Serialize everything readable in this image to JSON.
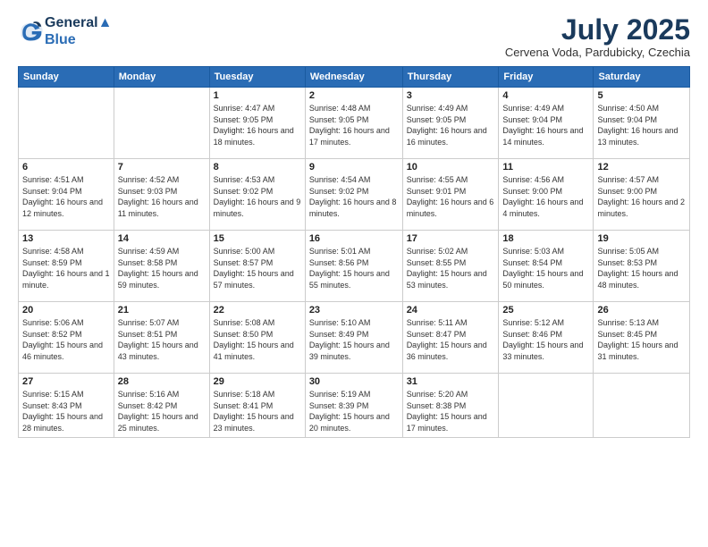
{
  "logo": {
    "line1": "General",
    "line2": "Blue"
  },
  "title": "July 2025",
  "location": "Cervena Voda, Pardubicky, Czechia",
  "weekdays": [
    "Sunday",
    "Monday",
    "Tuesday",
    "Wednesday",
    "Thursday",
    "Friday",
    "Saturday"
  ],
  "weeks": [
    [
      {
        "day": "",
        "info": ""
      },
      {
        "day": "",
        "info": ""
      },
      {
        "day": "1",
        "info": "Sunrise: 4:47 AM\nSunset: 9:05 PM\nDaylight: 16 hours and 18 minutes."
      },
      {
        "day": "2",
        "info": "Sunrise: 4:48 AM\nSunset: 9:05 PM\nDaylight: 16 hours and 17 minutes."
      },
      {
        "day": "3",
        "info": "Sunrise: 4:49 AM\nSunset: 9:05 PM\nDaylight: 16 hours and 16 minutes."
      },
      {
        "day": "4",
        "info": "Sunrise: 4:49 AM\nSunset: 9:04 PM\nDaylight: 16 hours and 14 minutes."
      },
      {
        "day": "5",
        "info": "Sunrise: 4:50 AM\nSunset: 9:04 PM\nDaylight: 16 hours and 13 minutes."
      }
    ],
    [
      {
        "day": "6",
        "info": "Sunrise: 4:51 AM\nSunset: 9:04 PM\nDaylight: 16 hours and 12 minutes."
      },
      {
        "day": "7",
        "info": "Sunrise: 4:52 AM\nSunset: 9:03 PM\nDaylight: 16 hours and 11 minutes."
      },
      {
        "day": "8",
        "info": "Sunrise: 4:53 AM\nSunset: 9:02 PM\nDaylight: 16 hours and 9 minutes."
      },
      {
        "day": "9",
        "info": "Sunrise: 4:54 AM\nSunset: 9:02 PM\nDaylight: 16 hours and 8 minutes."
      },
      {
        "day": "10",
        "info": "Sunrise: 4:55 AM\nSunset: 9:01 PM\nDaylight: 16 hours and 6 minutes."
      },
      {
        "day": "11",
        "info": "Sunrise: 4:56 AM\nSunset: 9:00 PM\nDaylight: 16 hours and 4 minutes."
      },
      {
        "day": "12",
        "info": "Sunrise: 4:57 AM\nSunset: 9:00 PM\nDaylight: 16 hours and 2 minutes."
      }
    ],
    [
      {
        "day": "13",
        "info": "Sunrise: 4:58 AM\nSunset: 8:59 PM\nDaylight: 16 hours and 1 minute."
      },
      {
        "day": "14",
        "info": "Sunrise: 4:59 AM\nSunset: 8:58 PM\nDaylight: 15 hours and 59 minutes."
      },
      {
        "day": "15",
        "info": "Sunrise: 5:00 AM\nSunset: 8:57 PM\nDaylight: 15 hours and 57 minutes."
      },
      {
        "day": "16",
        "info": "Sunrise: 5:01 AM\nSunset: 8:56 PM\nDaylight: 15 hours and 55 minutes."
      },
      {
        "day": "17",
        "info": "Sunrise: 5:02 AM\nSunset: 8:55 PM\nDaylight: 15 hours and 53 minutes."
      },
      {
        "day": "18",
        "info": "Sunrise: 5:03 AM\nSunset: 8:54 PM\nDaylight: 15 hours and 50 minutes."
      },
      {
        "day": "19",
        "info": "Sunrise: 5:05 AM\nSunset: 8:53 PM\nDaylight: 15 hours and 48 minutes."
      }
    ],
    [
      {
        "day": "20",
        "info": "Sunrise: 5:06 AM\nSunset: 8:52 PM\nDaylight: 15 hours and 46 minutes."
      },
      {
        "day": "21",
        "info": "Sunrise: 5:07 AM\nSunset: 8:51 PM\nDaylight: 15 hours and 43 minutes."
      },
      {
        "day": "22",
        "info": "Sunrise: 5:08 AM\nSunset: 8:50 PM\nDaylight: 15 hours and 41 minutes."
      },
      {
        "day": "23",
        "info": "Sunrise: 5:10 AM\nSunset: 8:49 PM\nDaylight: 15 hours and 39 minutes."
      },
      {
        "day": "24",
        "info": "Sunrise: 5:11 AM\nSunset: 8:47 PM\nDaylight: 15 hours and 36 minutes."
      },
      {
        "day": "25",
        "info": "Sunrise: 5:12 AM\nSunset: 8:46 PM\nDaylight: 15 hours and 33 minutes."
      },
      {
        "day": "26",
        "info": "Sunrise: 5:13 AM\nSunset: 8:45 PM\nDaylight: 15 hours and 31 minutes."
      }
    ],
    [
      {
        "day": "27",
        "info": "Sunrise: 5:15 AM\nSunset: 8:43 PM\nDaylight: 15 hours and 28 minutes."
      },
      {
        "day": "28",
        "info": "Sunrise: 5:16 AM\nSunset: 8:42 PM\nDaylight: 15 hours and 25 minutes."
      },
      {
        "day": "29",
        "info": "Sunrise: 5:18 AM\nSunset: 8:41 PM\nDaylight: 15 hours and 23 minutes."
      },
      {
        "day": "30",
        "info": "Sunrise: 5:19 AM\nSunset: 8:39 PM\nDaylight: 15 hours and 20 minutes."
      },
      {
        "day": "31",
        "info": "Sunrise: 5:20 AM\nSunset: 8:38 PM\nDaylight: 15 hours and 17 minutes."
      },
      {
        "day": "",
        "info": ""
      },
      {
        "day": "",
        "info": ""
      }
    ]
  ]
}
